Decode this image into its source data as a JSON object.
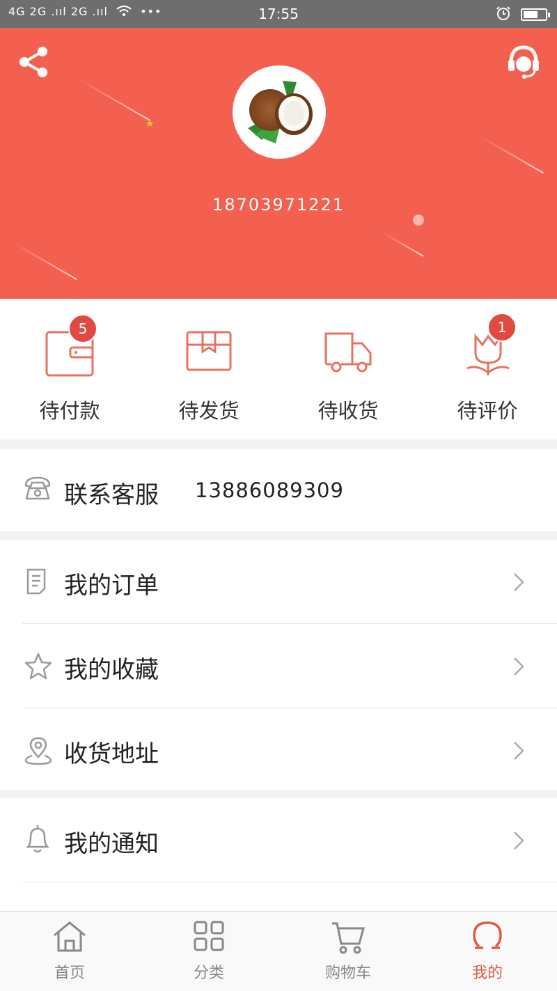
{
  "status_bar": {
    "signal": "4G 2G .ııl 2G .ııl",
    "dots": "•••",
    "time": "17:55"
  },
  "profile": {
    "phone": "18703971221"
  },
  "orders": [
    {
      "label": "待付款",
      "badge": "5",
      "icon": "wallet-icon"
    },
    {
      "label": "待发货",
      "badge": "",
      "icon": "box-icon"
    },
    {
      "label": "待收货",
      "badge": "",
      "icon": "truck-icon"
    },
    {
      "label": "待评价",
      "badge": "1",
      "icon": "flower-icon"
    }
  ],
  "contact": {
    "label": "联系客服",
    "number": "13886089309",
    "icon": "telephone-icon"
  },
  "menu": [
    {
      "label": "我的订单",
      "icon": "order-list-icon"
    },
    {
      "label": "我的收藏",
      "icon": "star-icon"
    },
    {
      "label": "收货地址",
      "icon": "location-pin-icon"
    }
  ],
  "menu2": [
    {
      "label": "我的通知",
      "icon": "bell-icon"
    }
  ],
  "tabs": [
    {
      "label": "首页",
      "icon": "home-icon",
      "active": false
    },
    {
      "label": "分类",
      "icon": "category-grid-icon",
      "active": false
    },
    {
      "label": "购物车",
      "icon": "cart-icon",
      "active": false
    },
    {
      "label": "我的",
      "icon": "profile-icon",
      "active": true
    }
  ],
  "colors": {
    "primary": "#f4604f",
    "accent": "#e05a48",
    "badge": "#e04a40"
  }
}
